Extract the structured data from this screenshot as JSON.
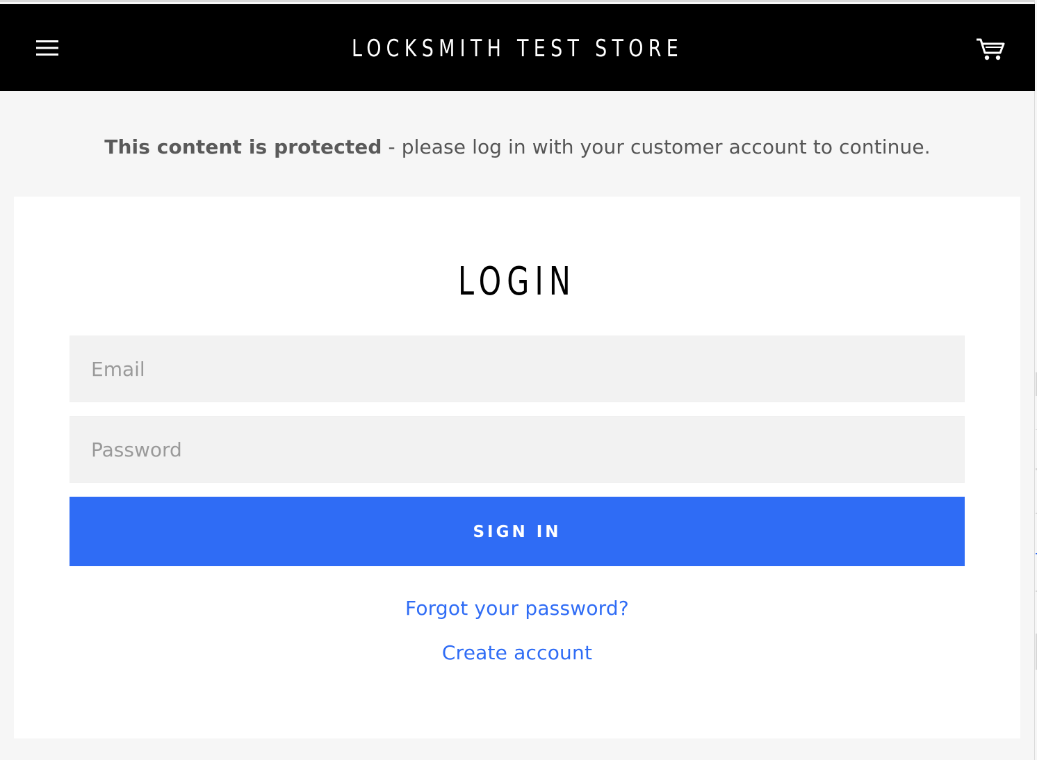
{
  "header": {
    "store_name": "LOCKSMITH TEST STORE",
    "menu_icon": "hamburger-icon",
    "cart_icon": "cart-icon",
    "background_color": "#000000"
  },
  "notice": {
    "bold": "This content is protected",
    "text": " - please log in with your customer account to continue."
  },
  "login": {
    "title": "LOGIN",
    "email_placeholder": "Email",
    "password_placeholder": "Password",
    "sign_in_label": "SIGN IN",
    "forgot_password": "Forgot your password?",
    "create_account": "Create account",
    "accent_color": "#2f6cf5"
  }
}
